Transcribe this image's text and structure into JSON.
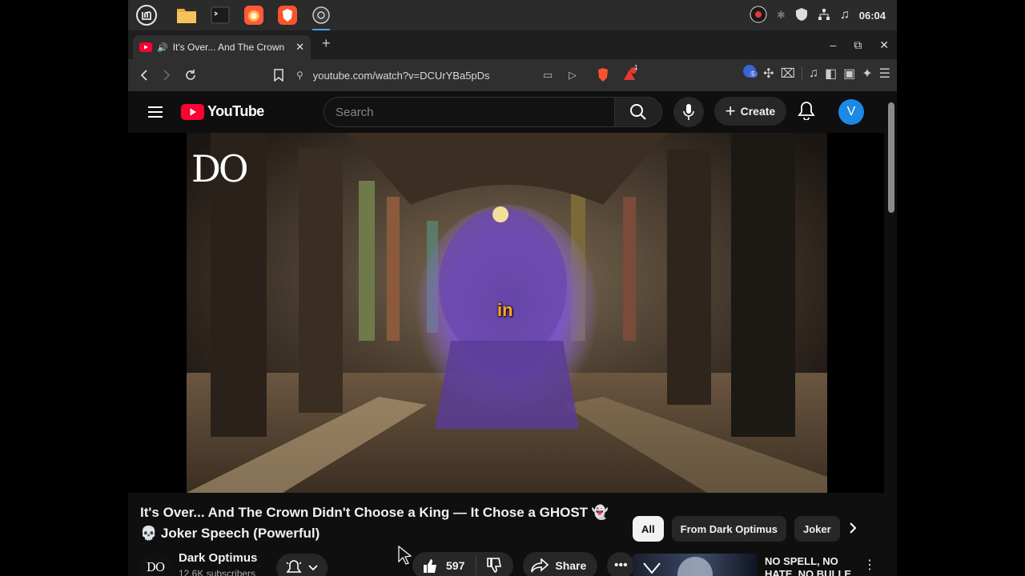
{
  "taskbar": {
    "apps": [
      "mint-menu-icon",
      "files-icon",
      "terminal-icon",
      "firefox-icon",
      "brave-icon",
      "obs-icon"
    ],
    "clock": "06:04"
  },
  "tab": {
    "title": "It's Over... And The Crown",
    "close": "✕",
    "new_tab": "+"
  },
  "window": {
    "minimize": "–",
    "maximize": "⧉",
    "close": "✕"
  },
  "address": {
    "url": "youtube.com/watch?v=DCUrYBa5pDs",
    "brave_badge": "1",
    "ext_badge": "5"
  },
  "youtube": {
    "logo_text": "YouTube",
    "search_placeholder": "Search",
    "create_label": "Create",
    "avatar_letter": "V"
  },
  "video": {
    "caption_word": "in",
    "watermark": "DO"
  },
  "meta": {
    "title_line1": "It's Over... And The Crown Didn't Choose a King — It Chose a GHOST 👻",
    "title_line2": "💀 Joker Speech (Powerful)",
    "channel_avatar": "DO",
    "channel_name": "Dark Optimus",
    "subscribers": "12.6K subscribers",
    "likes": "597",
    "share_label": "Share"
  },
  "chips": [
    {
      "label": "All",
      "active": true
    },
    {
      "label": "From Dark Optimus",
      "active": false
    },
    {
      "label": "Joker",
      "active": false
    }
  ],
  "recommendation": {
    "title": "NO SPELL, NO HATE, NO BULLE"
  },
  "colors": {
    "youtube_red": "#ff0033",
    "avatar_blue": "#1e88e5",
    "caption_orange": "#ffaa22"
  }
}
